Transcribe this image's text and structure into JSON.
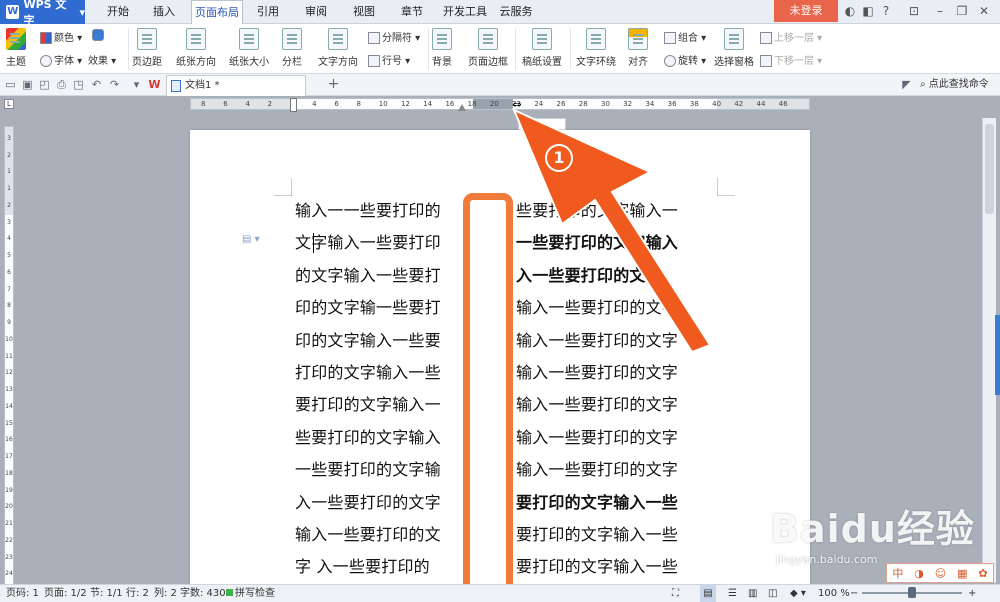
{
  "app": {
    "name": "WPS 文字",
    "logo_letter": "W"
  },
  "tabs": [
    {
      "label": "开始"
    },
    {
      "label": "插入"
    },
    {
      "label": "页面布局"
    },
    {
      "label": "引用"
    },
    {
      "label": "审阅"
    },
    {
      "label": "视图"
    },
    {
      "label": "章节"
    },
    {
      "label": "开发工具"
    },
    {
      "label": "云服务"
    }
  ],
  "active_tab": "页面布局",
  "login_label": "未登录",
  "ribbon": {
    "theme": "主题",
    "color": "颜色",
    "font": "字体",
    "effects": "效果",
    "margins": "页边距",
    "orientation": "纸张方向",
    "size": "纸张大小",
    "columns": "分栏",
    "text_direction": "文字方向",
    "breaks": "分隔符",
    "line_numbers": "行号",
    "background": "背景",
    "page_border": "页面边框",
    "paper_setup": "稿纸设置",
    "text_wrap": "文字环绕",
    "align": "对齐",
    "group": "组合",
    "rotate": "旋转",
    "selection_pane": "选择窗格",
    "bring_forward": "上移一层",
    "send_backward": "下移一层"
  },
  "document_tab": {
    "title": "文档1 *"
  },
  "search": {
    "label": "点此查找命令"
  },
  "ruler": {
    "h_ticks": [
      "8",
      "6",
      "4",
      "2",
      "2",
      "4",
      "6",
      "8",
      "10",
      "12",
      "14",
      "16",
      "18",
      "20",
      "22",
      "24",
      "26",
      "28",
      "30",
      "32",
      "34",
      "36",
      "38",
      "40",
      "42",
      "44",
      "46"
    ],
    "v_ticks": [
      "3",
      "2",
      "1",
      "1",
      "2",
      "3",
      "4",
      "5",
      "6",
      "7",
      "8",
      "9",
      "10",
      "11",
      "12",
      "13",
      "14",
      "15",
      "16",
      "17",
      "18",
      "19",
      "20",
      "21",
      "22",
      "23",
      "24"
    ]
  },
  "left_column": [
    "输入一一些要打印的",
    "文字输入一些要打印",
    "的文字输入一些要打",
    "印的文字输一些要打",
    "印的文字输入一些要",
    "打印的文字输入一些",
    "要打印的文字输入一",
    "些要打印的文字输入",
    "一些要打印的文字输",
    "入一些要打印的文字",
    "输入一些要打印的文",
    "字  入一些要打印的"
  ],
  "right_column": [
    "些要打印的文字输入一",
    "一些要打印的文字输入",
    "入一些要打印的文字",
    "输入一些要打印的文字",
    "输入一些要打印的文字",
    "输入一些要打印的文字",
    "输入一些要打印的文字",
    "输入一些要打印的文字",
    "输入一些要打印的文字",
    "要打印的文字输入一些",
    "要打印的文字输入一些",
    "要打印的文字输入一些"
  ],
  "annotation": {
    "step": "1",
    "color": "#ef7a3a"
  },
  "status": {
    "page_code": "页码: 1",
    "pages": "页面: 1/2",
    "section": "节: 1/1",
    "row": "行: 2",
    "col": "列: 2",
    "word_count": "字数: 430",
    "spell_check": "拼写检查",
    "zoom": "100 %",
    "zoom_level": 0.5
  },
  "watermark": {
    "brand": "Baidu经验",
    "url": "jingyan.baidu.com"
  },
  "colors": {
    "brand_blue": "#2f6bd1",
    "login_red": "#e8644a",
    "highlight_orange": "#ef7a3a"
  }
}
